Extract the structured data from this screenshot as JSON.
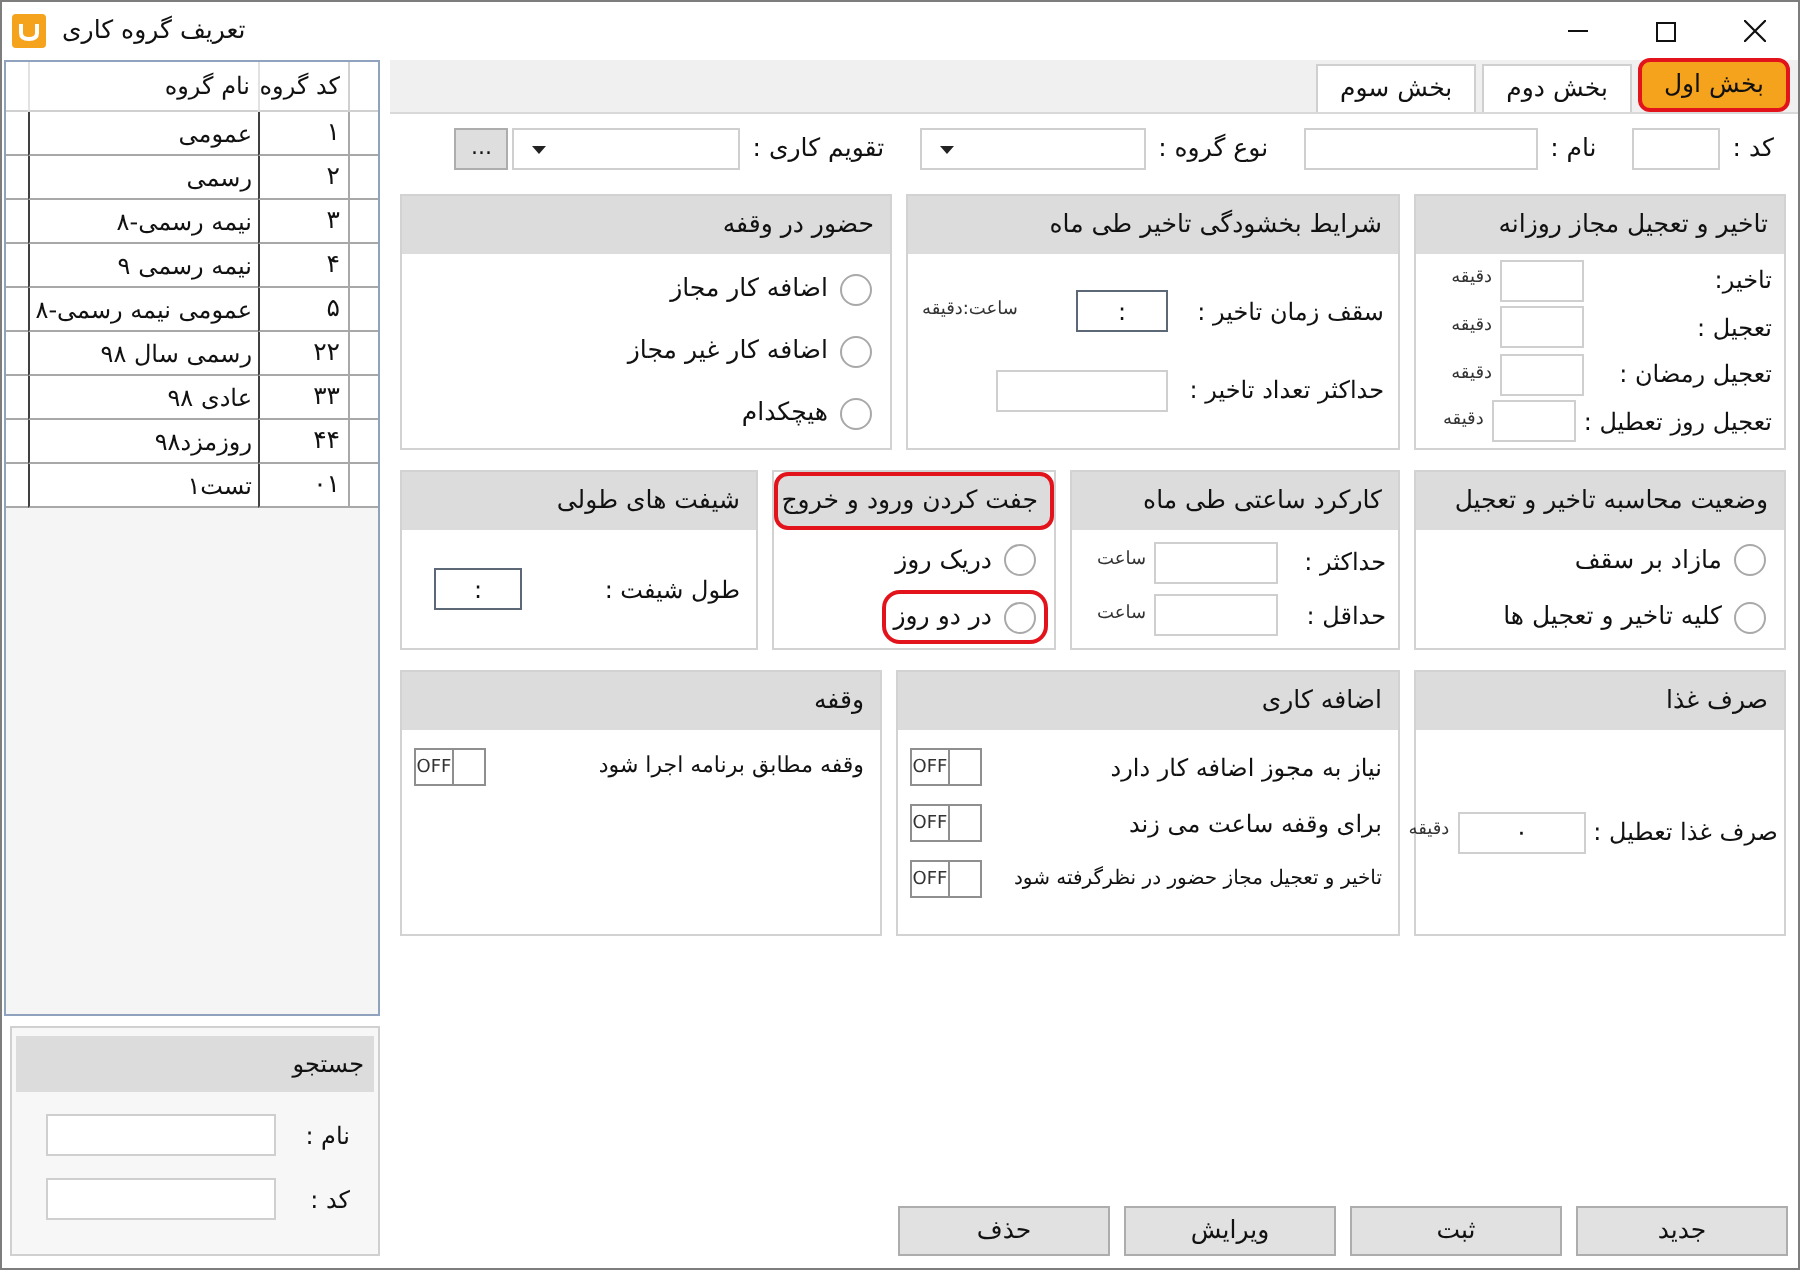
{
  "window": {
    "title": "تعریف گروه کاری"
  },
  "groups_table": {
    "columns": [
      "کد گروه",
      "نام گروه"
    ],
    "rows": [
      {
        "code": "۱",
        "name": "عمومی"
      },
      {
        "code": "۲",
        "name": "رسمی"
      },
      {
        "code": "۳",
        "name": "نیمه رسمی-۸"
      },
      {
        "code": "۴",
        "name": "نیمه رسمی ۹"
      },
      {
        "code": "۵",
        "name": "عمومی نیمه رسمی-۸"
      },
      {
        "code": "۲۲",
        "name": "رسمی سال ۹۸"
      },
      {
        "code": "۳۳",
        "name": "عادی ۹۸"
      },
      {
        "code": "۴۴",
        "name": "روزمزد۹۸"
      },
      {
        "code": "۰۱",
        "name": "تست۱"
      }
    ]
  },
  "search": {
    "title": "جستجو",
    "fields": [
      {
        "label": "نام :"
      },
      {
        "label": "کد :"
      }
    ]
  },
  "tabs": [
    {
      "label": "بخش اول",
      "selected": true,
      "highlighted": true
    },
    {
      "label": "بخش دوم",
      "selected": false,
      "highlighted": false
    },
    {
      "label": "بخش سوم",
      "selected": false,
      "highlighted": false
    }
  ],
  "header_fields": [
    {
      "kind": "text",
      "label": "کد :"
    },
    {
      "kind": "text",
      "label": "نام :"
    },
    {
      "kind": "dropdown",
      "label": "نوع گروه :"
    },
    {
      "kind": "dropdown",
      "label": "تقویم کاری :",
      "button": "..."
    }
  ],
  "panel_rows": [
    [
      {
        "title": "تاخیر و تعجیل مجاز روزانه",
        "highlighted": false,
        "items": [
          {
            "kind": "field",
            "label": "تاخیر:",
            "unit": "دقیقه"
          },
          {
            "kind": "field",
            "label": "تعجیل :",
            "unit": "دقیقه"
          },
          {
            "kind": "field",
            "label": "تعجیل رمضان :",
            "unit": "دقیقه"
          },
          {
            "kind": "field",
            "label": "تعجیل روز تعطیل :",
            "unit": "دقیقه"
          }
        ]
      },
      {
        "title": "شرایط بخشودگی تاخیر طی ماه",
        "highlighted": false,
        "items": [
          {
            "kind": "time_field",
            "label": "سقف زمان تاخیر :",
            "value": ":",
            "unit": "ساعت:دقیقه"
          },
          {
            "kind": "field",
            "label": "حداکثر تعداد تاخیر :"
          }
        ]
      },
      {
        "title": "حضور در وقفه",
        "highlighted": false,
        "items": [
          {
            "kind": "radio",
            "label": "اضافه کار مجاز",
            "checked": false,
            "highlighted": false
          },
          {
            "kind": "radio",
            "label": "اضافه کار غیر مجاز",
            "checked": false,
            "highlighted": false
          },
          {
            "kind": "radio",
            "label": "هیچکدام",
            "checked": false,
            "highlighted": false
          }
        ]
      }
    ],
    [
      {
        "title": "وضعیت محاسبه تاخیر و تعجیل",
        "highlighted": false,
        "items": [
          {
            "kind": "radio",
            "label": "مازاد بر سقف",
            "checked": false,
            "highlighted": false
          },
          {
            "kind": "radio",
            "label": "کلیه تاخیر و تعجیل ها",
            "checked": false,
            "highlighted": false
          }
        ]
      },
      {
        "title": "کارکرد ساعتی طی ماه",
        "highlighted": false,
        "items": [
          {
            "kind": "field",
            "label": "حداکثر :",
            "unit": "ساعت"
          },
          {
            "kind": "field",
            "label": "حداقل :",
            "unit": "ساعت"
          }
        ]
      },
      {
        "title": "جفت کردن ورود و خروج",
        "highlighted": true,
        "items": [
          {
            "kind": "radio",
            "label": "دریک روز",
            "checked": false,
            "highlighted": false
          },
          {
            "kind": "radio",
            "label": "در دو روز",
            "checked": false,
            "highlighted": true
          }
        ]
      },
      {
        "title": "شیفت های طولی",
        "highlighted": false,
        "items": [
          {
            "kind": "time_field",
            "label": "طول شیفت :",
            "value": ":"
          }
        ]
      }
    ],
    [
      {
        "title": "صرف غذا",
        "highlighted": false,
        "items": [
          {
            "kind": "field",
            "label": "صرف غذا تعطیل :",
            "value": "۰",
            "unit": "دقیقه"
          }
        ]
      },
      {
        "title": "اضافه کاری",
        "highlighted": false,
        "items": [
          {
            "kind": "toggle",
            "label": "نیاز به مجوز اضافه کار دارد",
            "on": false,
            "text": "OFF"
          },
          {
            "kind": "toggle",
            "label": "برای وقفه ساعت می زند",
            "on": false,
            "text": "OFF"
          },
          {
            "kind": "toggle",
            "label": "تاخیر و تعجیل مجاز حضور در نظرگرفته شود",
            "on": false,
            "text": "OFF"
          }
        ]
      },
      {
        "title": "وقفه",
        "highlighted": false,
        "items": [
          {
            "kind": "toggle",
            "label": "وقفه مطابق برنامه اجرا شود",
            "on": false,
            "text": "OFF"
          }
        ]
      }
    ]
  ],
  "buttons": [
    "جدید",
    "ثبت",
    "ویرایش",
    "حذف"
  ]
}
